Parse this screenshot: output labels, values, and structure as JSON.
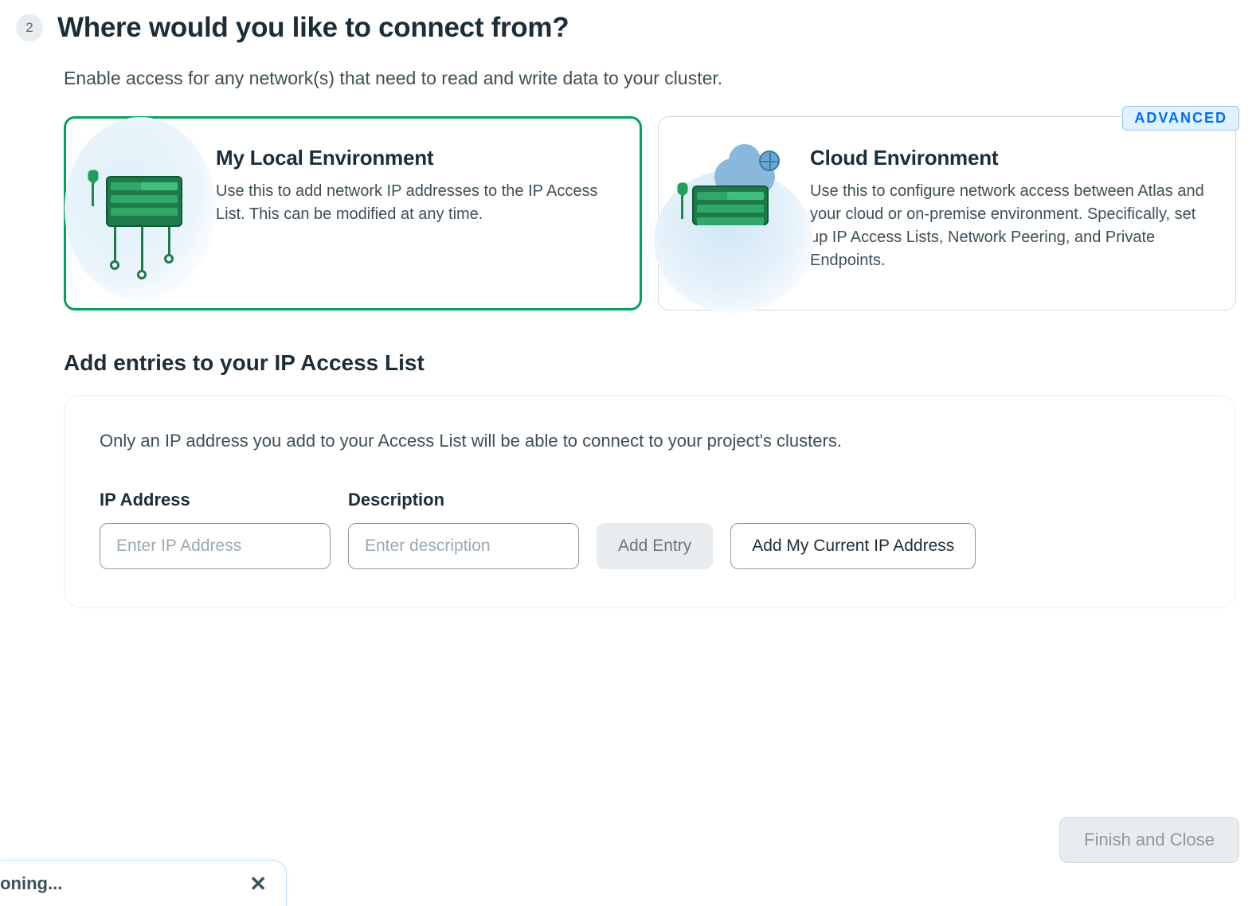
{
  "step": {
    "number": "2",
    "title": "Where would you like to connect from?",
    "subtitle": "Enable access for any network(s) that need to read and write data to your cluster."
  },
  "cards": {
    "local": {
      "title": "My Local Environment",
      "desc": "Use this to add network IP addresses to the IP Access List. This can be modified at any time."
    },
    "cloud": {
      "title": "Cloud Environment",
      "desc": "Use this to configure network access between Atlas and your cloud or on-premise environment. Specifically, set up IP Access Lists, Network Peering, and Private Endpoints.",
      "badge": "ADVANCED"
    }
  },
  "ip_section": {
    "title": "Add entries to your IP Access List",
    "note": "Only an IP address you add to your Access List will be able to connect to your project's clusters.",
    "ip_label": "IP Address",
    "ip_placeholder": "Enter IP Address",
    "desc_label": "Description",
    "desc_placeholder": "Enter description",
    "add_entry_btn": "Add Entry",
    "add_current_btn": "Add My Current IP Address"
  },
  "footer": {
    "finish_btn": "Finish and Close"
  },
  "toast": {
    "text": "ioning..."
  }
}
